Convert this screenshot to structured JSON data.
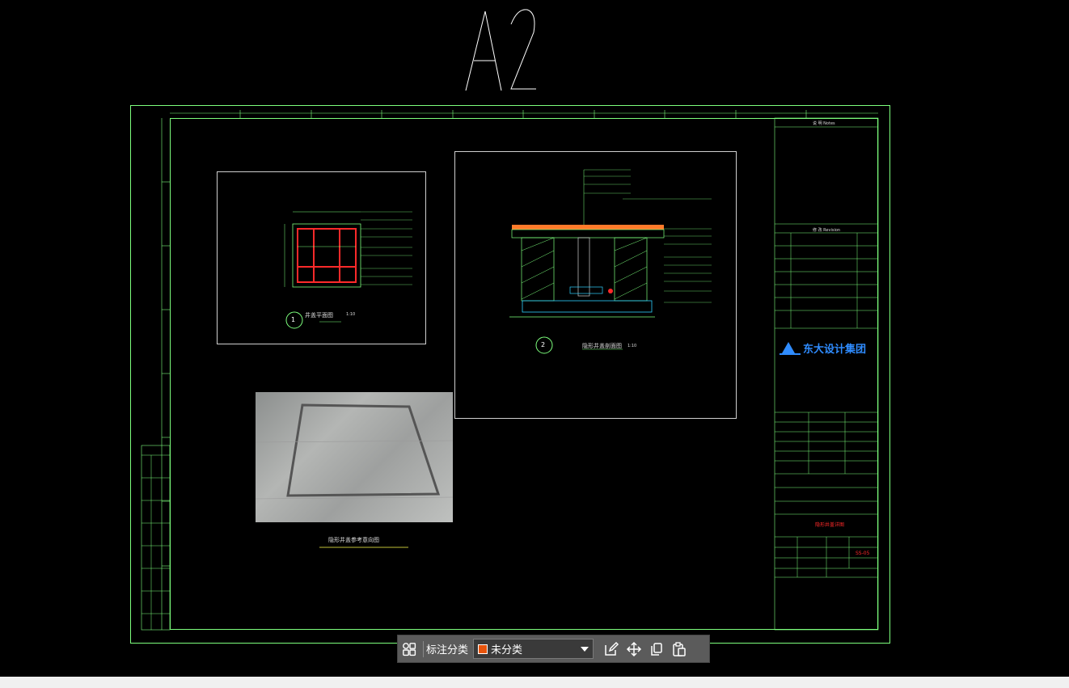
{
  "sheet_size_label": "A2",
  "drawing": {
    "detail1_title": "井盖平面图",
    "detail1_number": "1",
    "detail1_scale": "1:10",
    "detail2_title": "隐形井盖剖面图",
    "detail2_number": "2",
    "detail2_scale": "1:10",
    "photo_caption": "隐形井盖参考意向图",
    "notes_header": "说 明  Notes",
    "revision_header": "修 改  Revision",
    "company_name": "东大设计集团",
    "drawing_title_red": "隐形井盖详图",
    "sheet_number_red": "SS-05"
  },
  "toolbar": {
    "grid_icon": "grid-icon",
    "category_label": "标注分类",
    "category_value": "未分类",
    "category_color": "#e8540c",
    "edit_icon": "edit-icon",
    "move_icon": "move-icon",
    "copy_icon": "copy-icon",
    "paste_icon": "paste-icon"
  }
}
